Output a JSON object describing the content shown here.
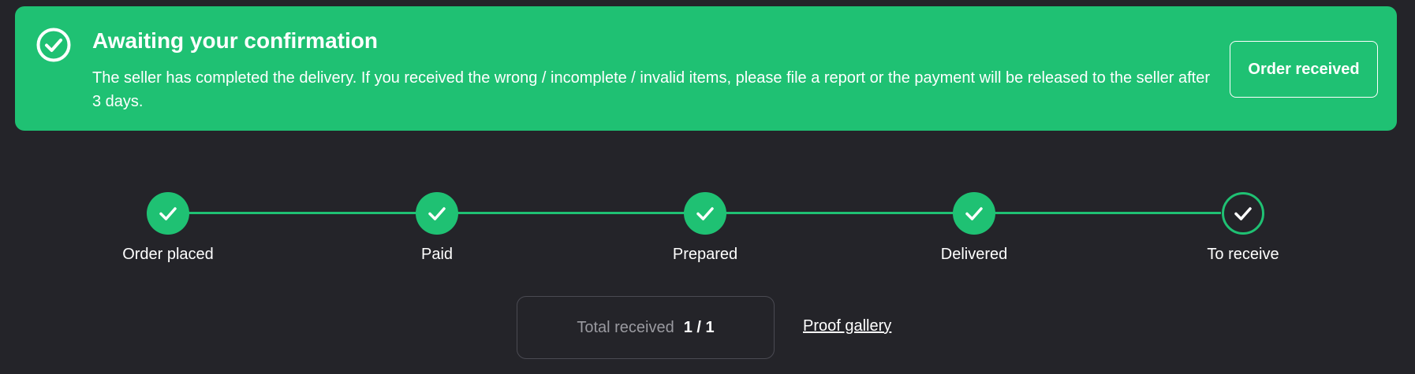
{
  "banner": {
    "title": "Awaiting your confirmation",
    "description": "The seller has completed the delivery. If you received the wrong / incomplete / invalid items, please file a report or the payment will be released to the seller after 3 days.",
    "button_label": "Order received",
    "icon": "check-circle-icon",
    "color": "#1fc173"
  },
  "steps": [
    {
      "label": "Order placed",
      "state": "completed"
    },
    {
      "label": "Paid",
      "state": "completed"
    },
    {
      "label": "Prepared",
      "state": "completed"
    },
    {
      "label": "Delivered",
      "state": "completed"
    },
    {
      "label": "To receive",
      "state": "current"
    }
  ],
  "total": {
    "label": "Total received",
    "value": "1 / 1"
  },
  "proof_link": "Proof gallery"
}
